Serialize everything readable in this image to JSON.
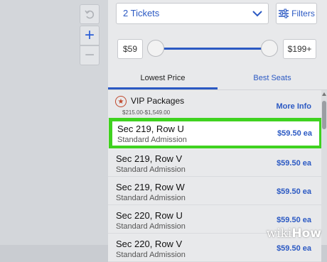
{
  "map": {
    "undo_icon": "undo-icon",
    "zoom_in_icon": "plus-icon",
    "zoom_out_icon": "minus-icon"
  },
  "toolbar": {
    "ticket_quantity": "2 Tickets",
    "filters_label": "Filters"
  },
  "price_filter": {
    "min_label": "$59",
    "max_label": "$199+",
    "min_value": 59,
    "max_value": 199
  },
  "tabs": [
    {
      "label": "Lowest Price",
      "active": true
    },
    {
      "label": "Best Seats",
      "active": false
    }
  ],
  "vip": {
    "title": "VIP Packages",
    "range": "$215.00-$1,549.00",
    "more_label": "More Info"
  },
  "listings": [
    {
      "section": "Sec 219, Row U",
      "admission": "Standard Admission",
      "price": "$59.50 ea",
      "highlighted": true
    },
    {
      "section": "Sec 219, Row V",
      "admission": "Standard Admission",
      "price": "$59.50 ea",
      "highlighted": false
    },
    {
      "section": "Sec 219, Row W",
      "admission": "Standard Admission",
      "price": "$59.50 ea",
      "highlighted": false
    },
    {
      "section": "Sec 220, Row U",
      "admission": "Standard Admission",
      "price": "$59.50 ea",
      "highlighted": false
    },
    {
      "section": "Sec 220, Row V",
      "admission": "Standard Admission",
      "price": "$59.50 ea",
      "highlighted": false
    }
  ],
  "colors": {
    "accent": "#2b59c3",
    "highlight": "#3fd21f",
    "vip_star": "#c0482c"
  },
  "watermark": {
    "prefix": "wiki",
    "suffix": "How"
  }
}
